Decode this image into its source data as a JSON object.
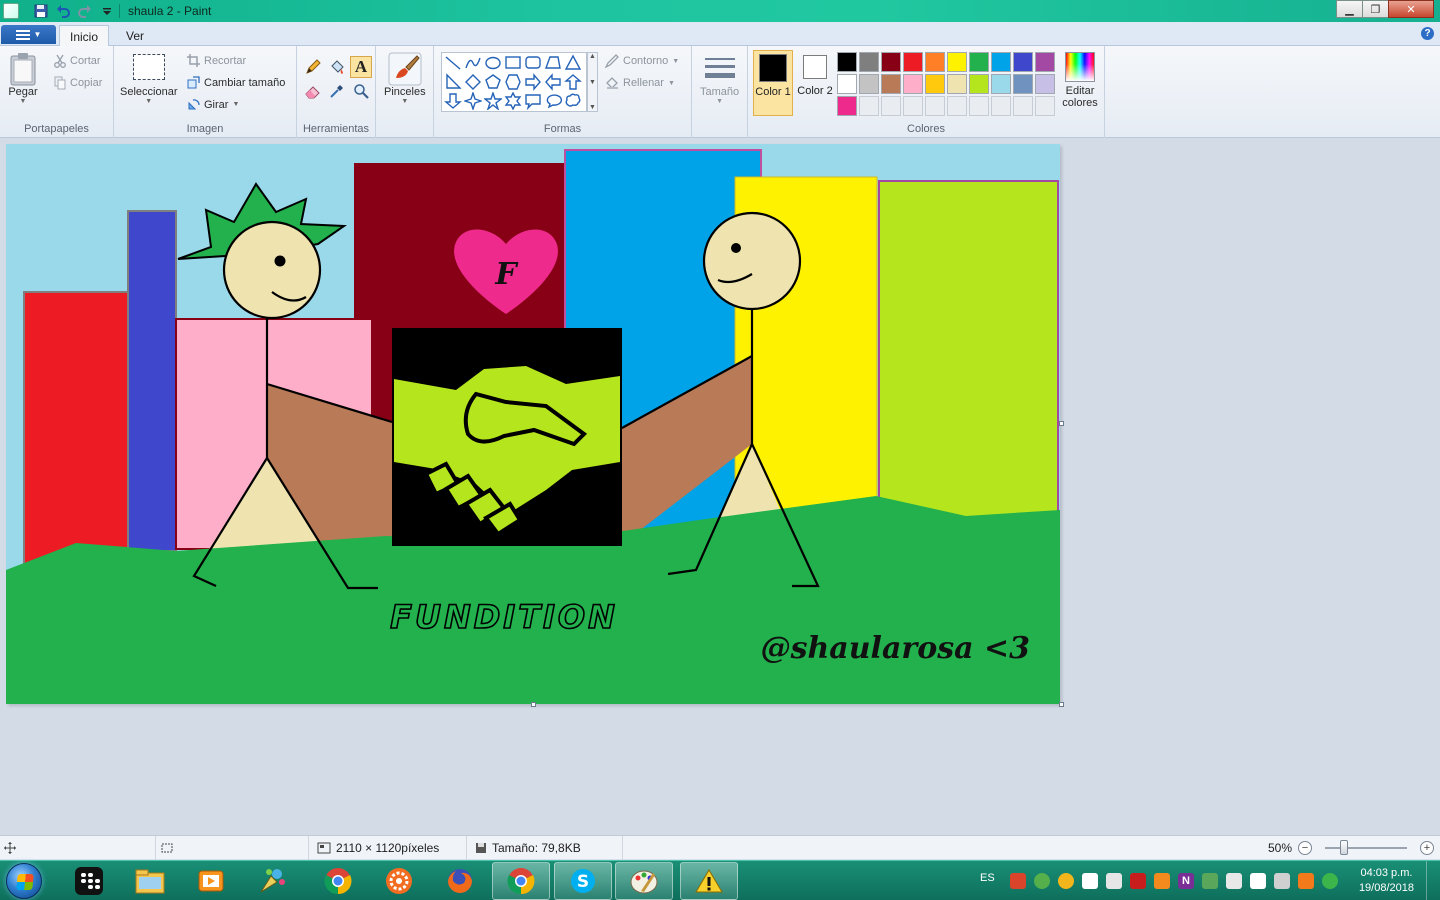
{
  "titlebar": {
    "title": "shaula 2 - Paint"
  },
  "tabs": {
    "home": "Inicio",
    "view": "Ver"
  },
  "clipboard": {
    "paste": "Pegar",
    "cut": "Cortar",
    "copy": "Copiar",
    "label": "Portapapeles"
  },
  "image": {
    "select": "Seleccionar",
    "crop": "Recortar",
    "resize": "Cambiar tamaño",
    "rotate": "Girar",
    "label": "Imagen"
  },
  "tools": {
    "label": "Herramientas",
    "selected": "text-tool"
  },
  "brushes": {
    "label": "Pinceles"
  },
  "shapes": {
    "outline": "Contorno",
    "fill": "Rellenar",
    "label": "Formas"
  },
  "size": {
    "label": "Tamaño"
  },
  "colors": {
    "color1_label": "Color 1",
    "color2_label": "Color 2",
    "edit_label": "Editar colores",
    "label": "Colores",
    "color1": "#000000",
    "color2": "#ffffff",
    "palette": [
      "#000000",
      "#7f7f7f",
      "#880015",
      "#ed1c24",
      "#ff7f27",
      "#fff200",
      "#22b14c",
      "#00a2e8",
      "#3f48cc",
      "#a349a4",
      "#ffffff",
      "#c3c3c3",
      "#b97a57",
      "#ffaec9",
      "#ffc90e",
      "#efe4b0",
      "#b5e61d",
      "#99d9ea",
      "#7092be",
      "#c8bfe7",
      "#ee2a8c",
      "",
      "",
      "",
      "",
      "",
      "",
      "",
      "",
      ""
    ]
  },
  "drawing": {
    "heart_letter": "F",
    "title_text": "FUNDITION",
    "signature": "@shaularosa <3"
  },
  "status": {
    "dimensions": "2110 × 1120píxeles",
    "filesize": "Tamaño: 79,8KB",
    "zoom": "50%",
    "zoom_level_percent": 50
  },
  "taskbar": {
    "language": "ES",
    "time": "04:03 p.m.",
    "date": "19/08/2018",
    "apps": [
      "blackberry-icon",
      "file-explorer-icon",
      "media-player-icon",
      "paint-splash-icon",
      "chrome-icon",
      "settings-gear-icon",
      "firefox-icon",
      "chrome-icon",
      "skype-icon",
      "paint-icon",
      "warning-icon"
    ]
  }
}
